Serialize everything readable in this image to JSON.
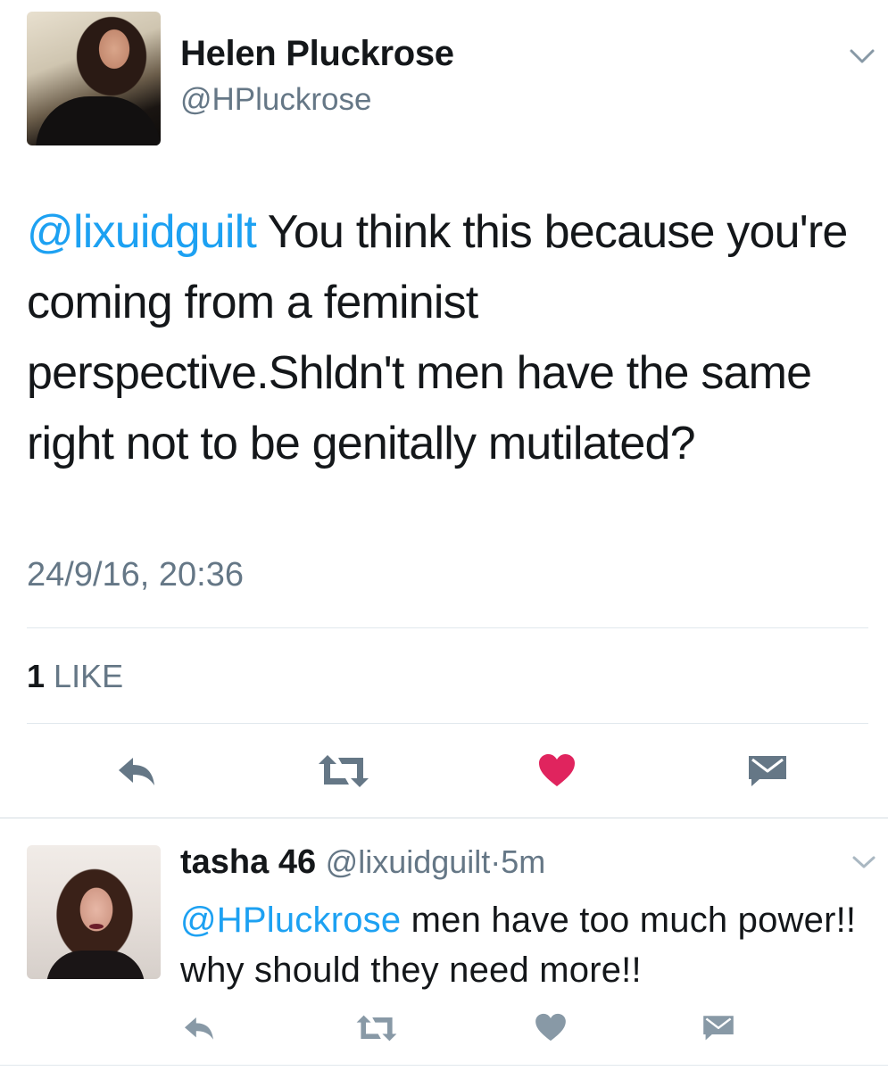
{
  "tweet": {
    "author_name": "Helen Pluckrose",
    "author_handle": "@HPluckrose",
    "mention": "@lixuidguilt",
    "text": " You think this because you're coming from a feminist perspective.Shldn't men have the same right not to be genitally mutilated?",
    "timestamp": "24/9/16, 20:36",
    "like_count": "1",
    "like_label": "LIKE",
    "liked": true
  },
  "reply": {
    "author_name": "tasha 46",
    "author_handle": "@lixuidguilt",
    "separator": "·",
    "time_ago": "5m",
    "mention": "@HPluckrose",
    "text": " men have too much power!! why should they need more!!"
  },
  "icons": {
    "more": "chevron-down-icon",
    "reply": "reply-icon",
    "retweet": "retweet-icon",
    "like": "heart-icon",
    "dm": "envelope-icon"
  },
  "colors": {
    "link": "#1da1f2",
    "like_active": "#e0245e",
    "secondary_text": "#657786",
    "action_gray": "#8899a6",
    "action_dark": "#657786"
  }
}
